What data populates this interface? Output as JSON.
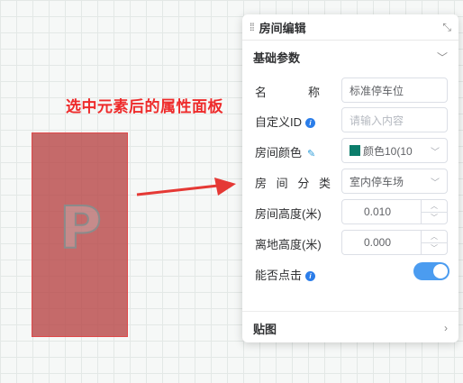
{
  "annotation": "选中元素后的属性面板",
  "canvas": {
    "element_icon": "parking-p-icon"
  },
  "panel": {
    "title": "房间编辑",
    "drag_icon": "grip-dots-icon",
    "collapse_icon": "collapse-arrows-icon",
    "basic_section": "基础参数",
    "fields": {
      "name": {
        "label": "名称",
        "chars": [
          "名",
          "称"
        ],
        "value": "标准停车位"
      },
      "custom_id": {
        "label": "自定义ID",
        "placeholder": "请输入内容"
      },
      "room_color": {
        "label": "房间颜色",
        "value": "颜色10(10",
        "color": "#0b7d6b"
      },
      "room_category": {
        "label": "房间分类",
        "chars": [
          "房",
          "间",
          "分",
          "类"
        ],
        "value": "室内停车场"
      },
      "room_height": {
        "label": "房间高度(米)",
        "value": "0.010"
      },
      "ground_height": {
        "label": "离地高度(米)",
        "value": "0.000"
      },
      "clickable": {
        "label": "能否点击",
        "enabled": true
      }
    },
    "texture_section": "贴图"
  },
  "colors": {
    "annotation": "#ee2b2b",
    "element_fill": "#b94a4a",
    "switch_on": "#4b9cf0"
  }
}
